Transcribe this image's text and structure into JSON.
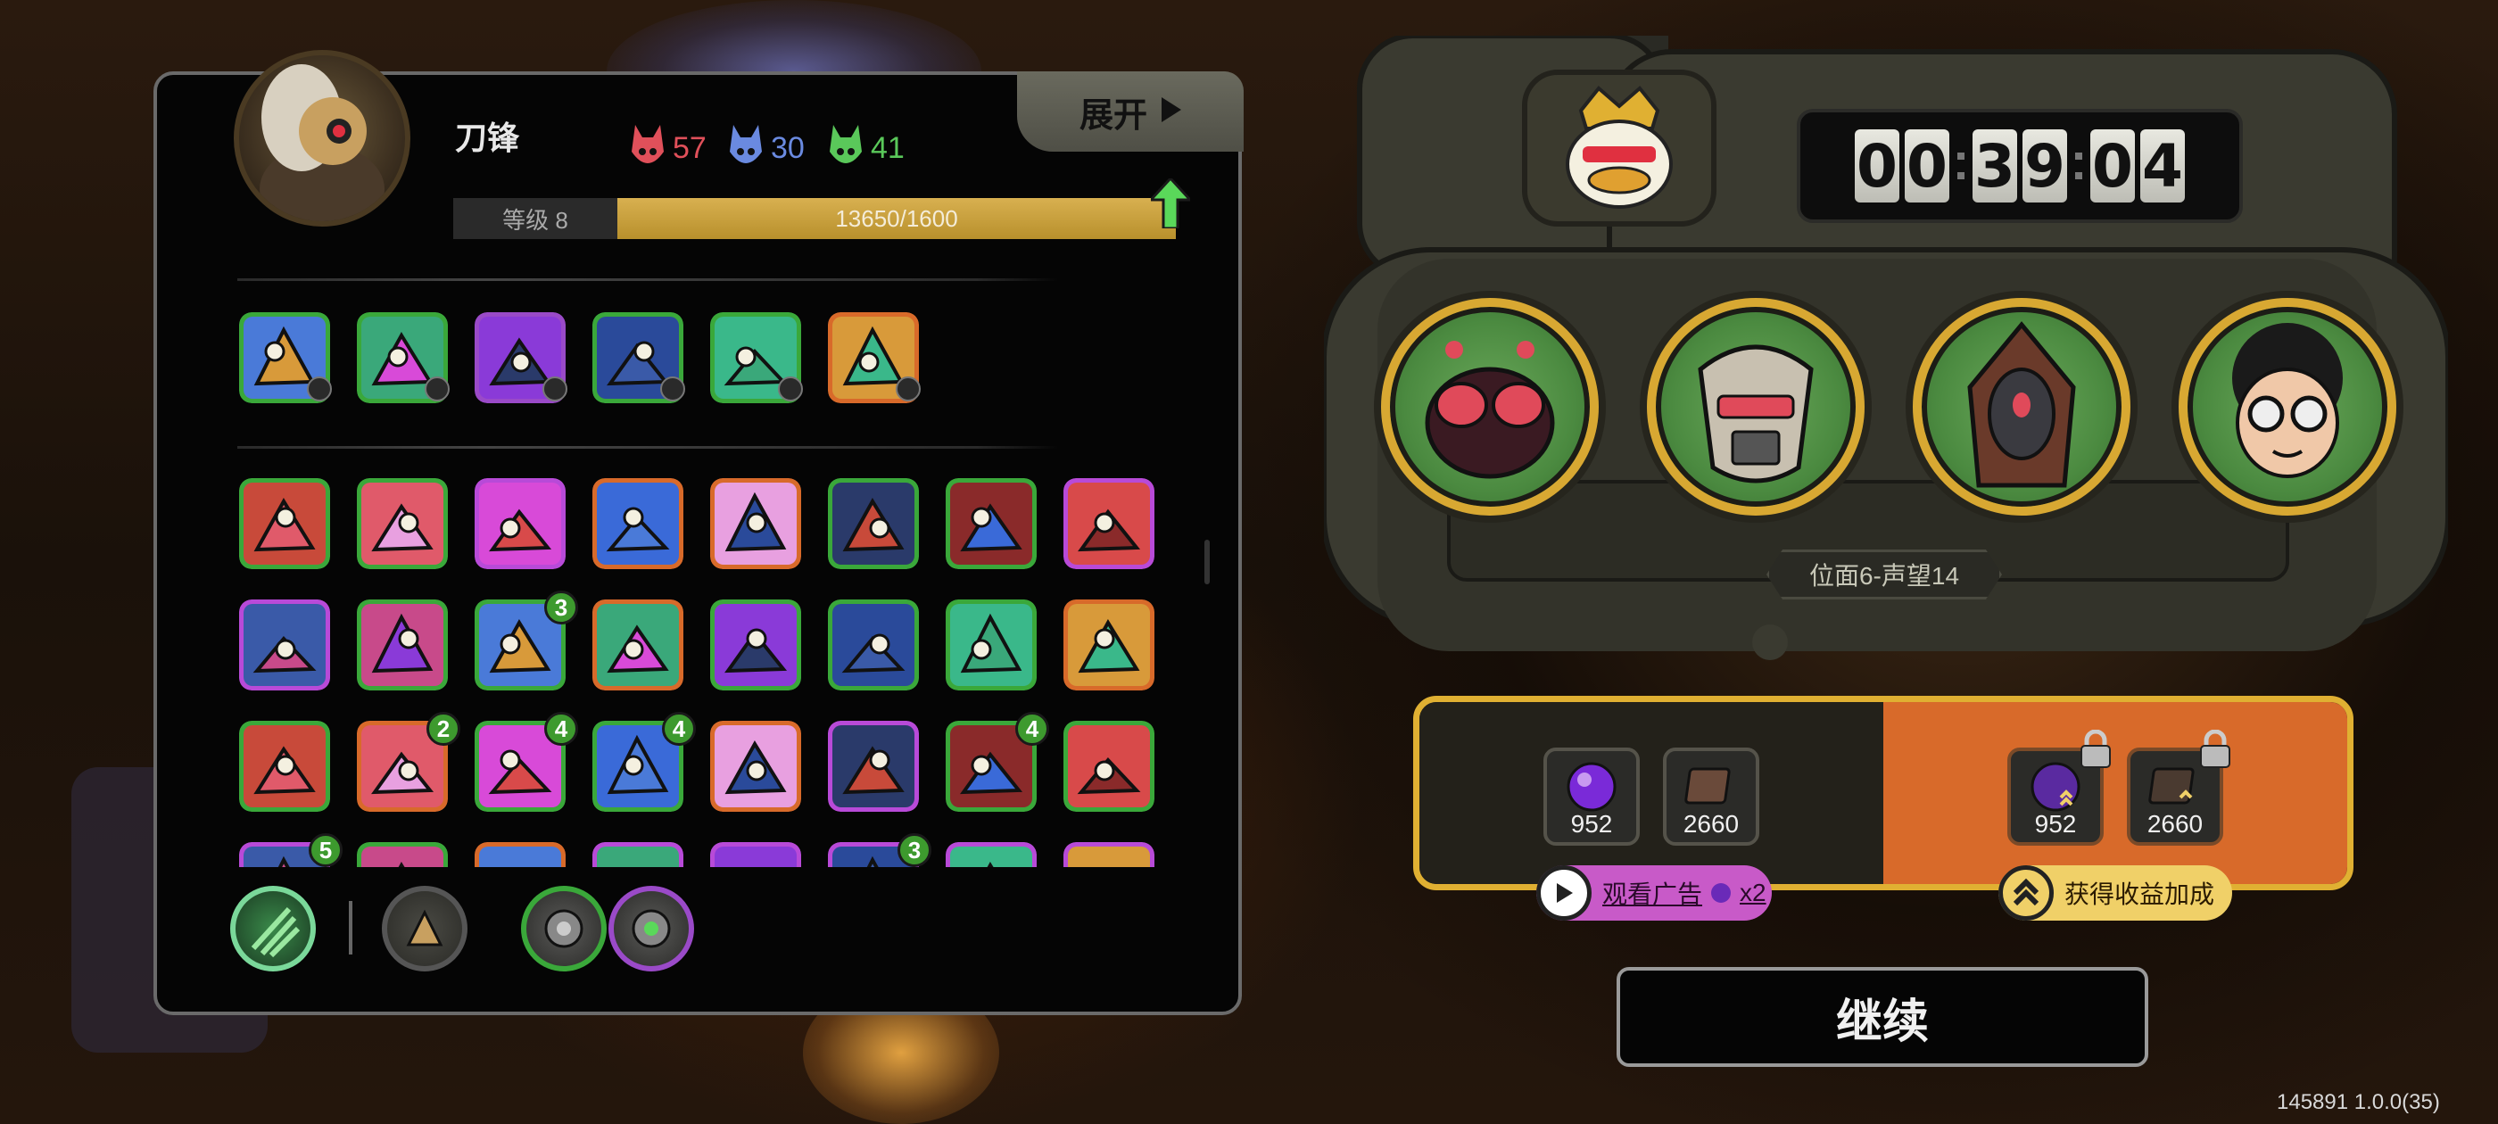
{
  "player": {
    "name": "刀锋",
    "stats": [
      {
        "name": "red-mask",
        "value": "57",
        "color": "#e0505a"
      },
      {
        "name": "blue-mask",
        "value": "30",
        "color": "#6a8ae0"
      },
      {
        "name": "green-mask",
        "value": "41",
        "color": "#5ac85a"
      }
    ],
    "level_label": "等级 8",
    "xp_text": "13650/1600",
    "xp_progress": 1.0
  },
  "expand_button": {
    "label": "展开",
    "icon": "play-triangle-icon"
  },
  "equipped_skills": [
    {
      "name": "waterfall-skill-icon",
      "border": "#3aa83a"
    },
    {
      "name": "prism-skill-icon",
      "border": "#3aa83a"
    },
    {
      "name": "dark-orb-skill-icon",
      "border": "#9a4ac8"
    },
    {
      "name": "lightning-skill-icon",
      "border": "#3aa83a"
    },
    {
      "name": "arrow-up-skill-icon",
      "border": "#3aa83a"
    },
    {
      "name": "sword-skill-icon",
      "border": "#d86a2a"
    }
  ],
  "skill_grid": [
    {
      "name": "tower-skill-icon",
      "border": "#3aa83a",
      "badge": null
    },
    {
      "name": "cursor-skill-icon",
      "border": "#3aa83a",
      "badge": null
    },
    {
      "name": "punch-skill-icon",
      "border": "#b84ad8",
      "badge": null
    },
    {
      "name": "shield-skill-icon",
      "border": "#d86a2a",
      "badge": null
    },
    {
      "name": "star-skill-icon",
      "border": "#d86a2a",
      "badge": null
    },
    {
      "name": "arrows-skill-icon",
      "border": "#3aa83a",
      "badge": null
    },
    {
      "name": "storm-skill-icon",
      "border": "#3aa83a",
      "badge": null
    },
    {
      "name": "figure-skill-icon",
      "border": "#b84ad8",
      "badge": null
    },
    {
      "name": "book-skill-icon",
      "border": "#b84ad8",
      "badge": null
    },
    {
      "name": "eye-skill-icon",
      "border": "#3aa83a",
      "badge": null
    },
    {
      "name": "feather-skill-icon",
      "border": "#3aa83a",
      "badge": "3"
    },
    {
      "name": "legs-skill-icon",
      "border": "#d86a2a",
      "badge": null
    },
    {
      "name": "beast-skill-icon",
      "border": "#3aa83a",
      "badge": null
    },
    {
      "name": "claw-skill-icon",
      "border": "#3aa83a",
      "badge": null
    },
    {
      "name": "bolt-skill-icon",
      "border": "#3aa83a",
      "badge": null
    },
    {
      "name": "ghost-skill-icon",
      "border": "#d86a2a",
      "badge": null
    },
    {
      "name": "burst-skill-icon",
      "border": "#3aa83a",
      "badge": null
    },
    {
      "name": "spikes-skill-icon",
      "border": "#d86a2a",
      "badge": "2"
    },
    {
      "name": "fish-skill-icon",
      "border": "#3aa83a",
      "badge": "4"
    },
    {
      "name": "bird-skill-icon",
      "border": "#3aa83a",
      "badge": "4"
    },
    {
      "name": "tomb-skill-icon",
      "border": "#d86a2a",
      "badge": null
    },
    {
      "name": "wind-skill-icon",
      "border": "#b84ad8",
      "badge": null
    },
    {
      "name": "crystal-skill-icon",
      "border": "#3aa83a",
      "badge": "4"
    },
    {
      "name": "mermaid-skill-icon",
      "border": "#3aa83a",
      "badge": null
    },
    {
      "name": "purple-skill-icon",
      "border": "#b84ad8",
      "badge": "5"
    },
    {
      "name": "horns-skill-icon",
      "border": "#3aa83a",
      "badge": null
    },
    {
      "name": "bull-skill-icon",
      "border": "#d86a2a",
      "badge": null
    },
    {
      "name": "fang-skill-icon",
      "border": "#b84ad8",
      "badge": null
    },
    {
      "name": "shell-skill-icon",
      "border": "#b84ad8",
      "badge": null
    },
    {
      "name": "serpent-skill-icon",
      "border": "#b84ad8",
      "badge": "3"
    },
    {
      "name": "flame-skill-icon",
      "border": "#b84ad8",
      "badge": null
    },
    {
      "name": "wing-skill-icon",
      "border": "#b84ad8",
      "badge": null
    }
  ],
  "bottom_icons": [
    {
      "name": "grass-slash-icon",
      "ring": "#7ad89a"
    },
    {
      "name": "lion-emblem-icon",
      "ring": "#555"
    },
    {
      "name": "triangle-rune-icon",
      "ring": "#3aa83a"
    },
    {
      "name": "heart-rune-icon",
      "ring": "#9a4ac8"
    }
  ],
  "timer": {
    "digits": [
      "0",
      "0",
      "3",
      "9",
      "0",
      "4"
    ]
  },
  "boss_icon": "crowned-duck-icon",
  "enemies": [
    {
      "name": "insect-enemy-icon"
    },
    {
      "name": "armored-enemy-icon"
    },
    {
      "name": "hooded-enemy-icon"
    },
    {
      "name": "glasses-kid-enemy-icon"
    }
  ],
  "stage_label": "位面6-声望14",
  "rewards": {
    "free": [
      {
        "name": "purple-orb-icon",
        "count": "952"
      },
      {
        "name": "book-tome-icon",
        "count": "2660"
      }
    ],
    "locked": [
      {
        "name": "purple-orb-locked-icon",
        "count": "952"
      },
      {
        "name": "book-tome-locked-icon",
        "count": "2660"
      }
    ],
    "ad_button": "观看广告",
    "ad_multiplier": "x2",
    "bonus_button": "获得收益加成",
    "colors": {
      "border": "#e0b032",
      "locked_bg": "#d86a2a"
    }
  },
  "continue_button": "继续",
  "version": "145891 1.0.0(35)"
}
